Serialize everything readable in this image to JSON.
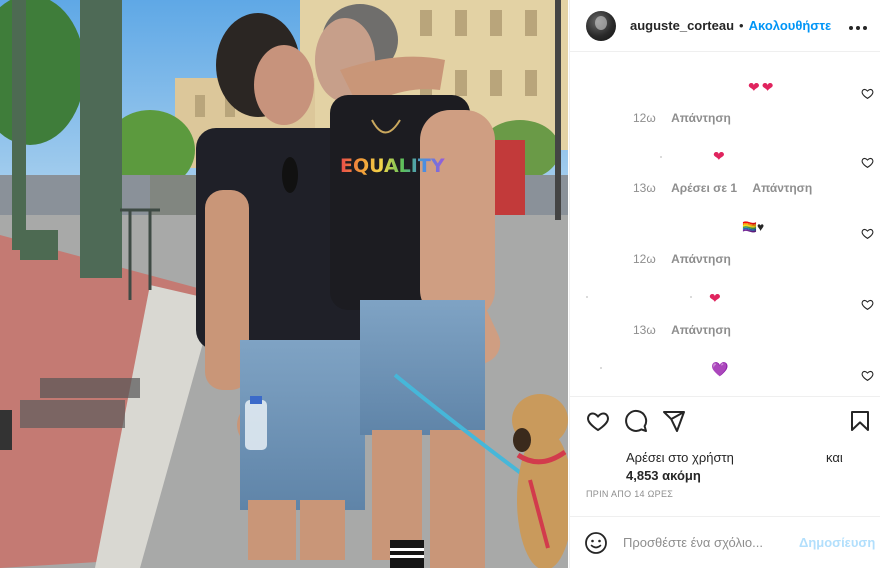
{
  "post": {
    "username": "auguste_corteau",
    "separator": "•",
    "follow_label": "Ακολουθήστε",
    "more_label": "•••"
  },
  "photo": {
    "shirt_text": "EQUALITY"
  },
  "comments": [
    {
      "emoji": "❤❤",
      "time": "12ω",
      "likes_text": "",
      "reply_label": "Απάντηση"
    },
    {
      "emoji": "❤",
      "time": "13ω",
      "likes_text": "Αρέσει σε 1",
      "reply_label": "Απάντηση"
    },
    {
      "emoji": "🏳️‍🌈♥",
      "time": "12ω",
      "likes_text": "",
      "reply_label": "Απάντηση"
    },
    {
      "emoji": "❤",
      "time": "13ω",
      "likes_text": "",
      "reply_label": "Απάντηση"
    },
    {
      "emoji": "💜",
      "time": "",
      "likes_text": "",
      "reply_label": ""
    }
  ],
  "likes": {
    "prefix": "Αρέσει στο χρήστη",
    "and": "και",
    "count": "4,853 ακόμη"
  },
  "timestamp": "ΠΡΙΝ ΑΠΟ 14 ΩΡΕΣ",
  "add_comment": {
    "placeholder": "Προσθέστε ένα σχόλιο...",
    "post_label": "Δημοσίευση"
  },
  "icons": {
    "like": "heart-icon",
    "comment": "comment-icon",
    "share": "share-icon",
    "save": "bookmark-icon",
    "emoji": "emoji-icon",
    "more": "more-icon"
  },
  "colors": {
    "accent": "#0095f6",
    "post_disabled": "#b2dffc",
    "heart_red": "#e0245e",
    "heart_purple": "#8e6cd6",
    "muted": "#8e8e8e"
  }
}
